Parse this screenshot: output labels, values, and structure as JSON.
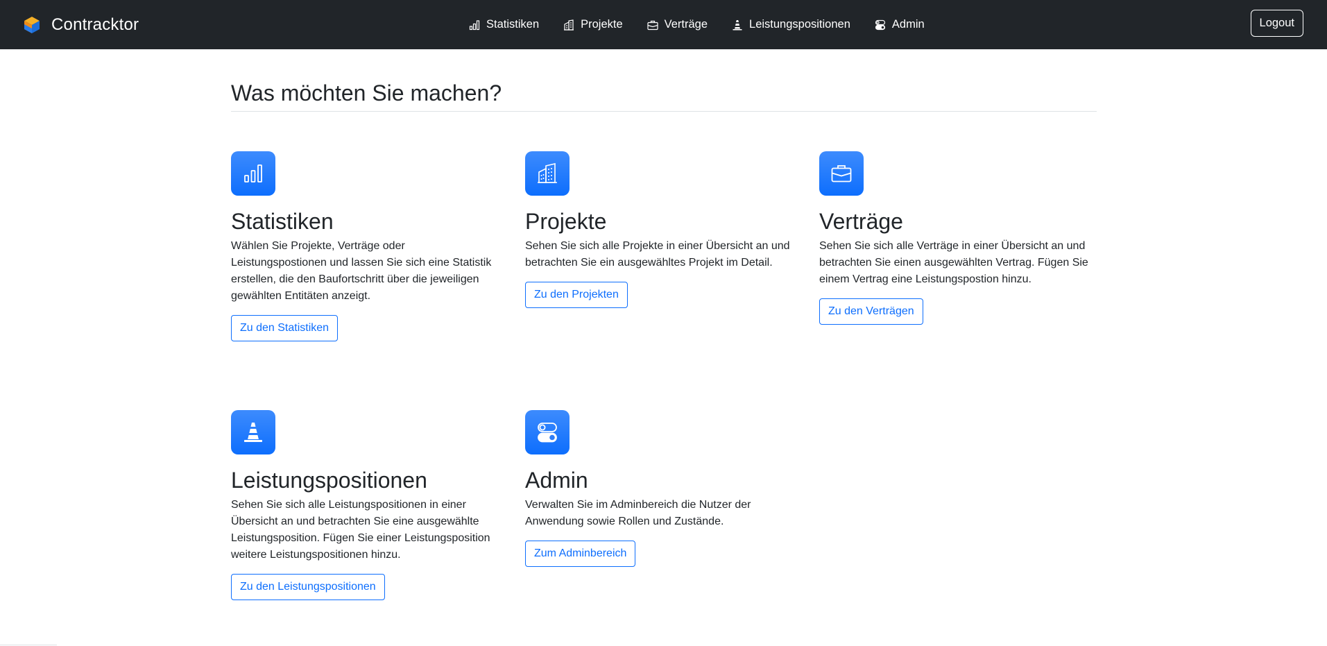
{
  "navbar": {
    "brand": "Contracktor",
    "links": [
      {
        "label": "Statistiken",
        "icon": "bar-chart-icon"
      },
      {
        "label": "Projekte",
        "icon": "buildings-icon"
      },
      {
        "label": "Verträge",
        "icon": "briefcase-icon"
      },
      {
        "label": "Leistungspositionen",
        "icon": "traffic-cone-icon"
      },
      {
        "label": "Admin",
        "icon": "toggles-icon"
      }
    ],
    "logout_label": "Logout"
  },
  "main": {
    "title": "Was möchten Sie machen?",
    "cards": [
      {
        "title": "Statistiken",
        "text": "Wählen Sie Projekte, Verträge oder Leistungspostionen und lassen Sie sich eine Statistik erstellen, die den Baufortschritt über die jeweiligen gewählten Entitäten anzeigt.",
        "button": "Zu den Statistiken",
        "icon": "bar-chart-icon"
      },
      {
        "title": "Projekte",
        "text": "Sehen Sie sich alle Projekte in einer Übersicht an und betrachten Sie ein ausgewähltes Projekt im Detail.",
        "button": "Zu den Projekten",
        "icon": "buildings-icon"
      },
      {
        "title": "Verträge",
        "text": "Sehen Sie sich alle Verträge in einer Übersicht an und betrachten Sie einen ausgewählten Vertrag. Fügen Sie einem Vertrag eine Leistungspostion hinzu.",
        "button": "Zu den Verträgen",
        "icon": "briefcase-icon"
      },
      {
        "title": "Leistungspositionen",
        "text": "Sehen Sie sich alle Leistungspositionen in einer Übersicht an und betrachten Sie eine ausgewählte Leistungsposition. Fügen Sie einer Leistungsposition weitere Leistungspositionen hinzu.",
        "button": "Zu den Leistungspositionen",
        "icon": "traffic-cone-icon"
      },
      {
        "title": "Admin",
        "text": "Verwalten Sie im Adminbereich die Nutzer der Anwendung sowie Rollen und Zustände.",
        "button": "Zum Adminbereich",
        "icon": "toggles-icon"
      }
    ]
  },
  "colors": {
    "navbar_bg": "#212529",
    "primary": "#0d6efd",
    "text": "#212529",
    "logo_blue": "#1e6fd9",
    "logo_orange": "#f5a623"
  }
}
